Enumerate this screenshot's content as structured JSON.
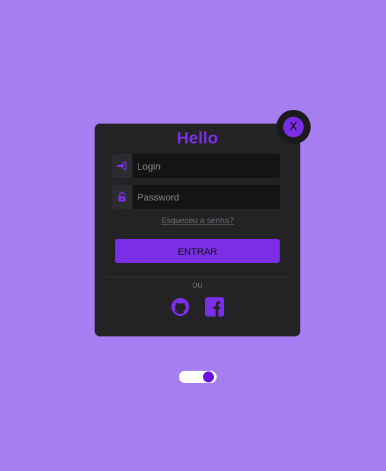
{
  "close_button": {
    "label": "X"
  },
  "card": {
    "title": "Hello",
    "login_field": {
      "placeholder": "Login",
      "value": "",
      "icon": "sign-in-icon"
    },
    "password_field": {
      "placeholder": "Password",
      "value": "",
      "icon": "unlock-icon"
    },
    "forgot_link": "Esqueceu a senha?",
    "submit_label": "ENTRAR",
    "or_label": "ou",
    "social": [
      {
        "name": "github",
        "icon": "github-icon"
      },
      {
        "name": "facebook",
        "icon": "facebook-icon"
      }
    ]
  },
  "theme_toggle": {
    "on": true
  },
  "colors": {
    "background": "#a67ef2",
    "card": "#232225",
    "accent": "#7a2ee6",
    "input": "#141414",
    "toggle_knob": "#6a0fe0"
  }
}
